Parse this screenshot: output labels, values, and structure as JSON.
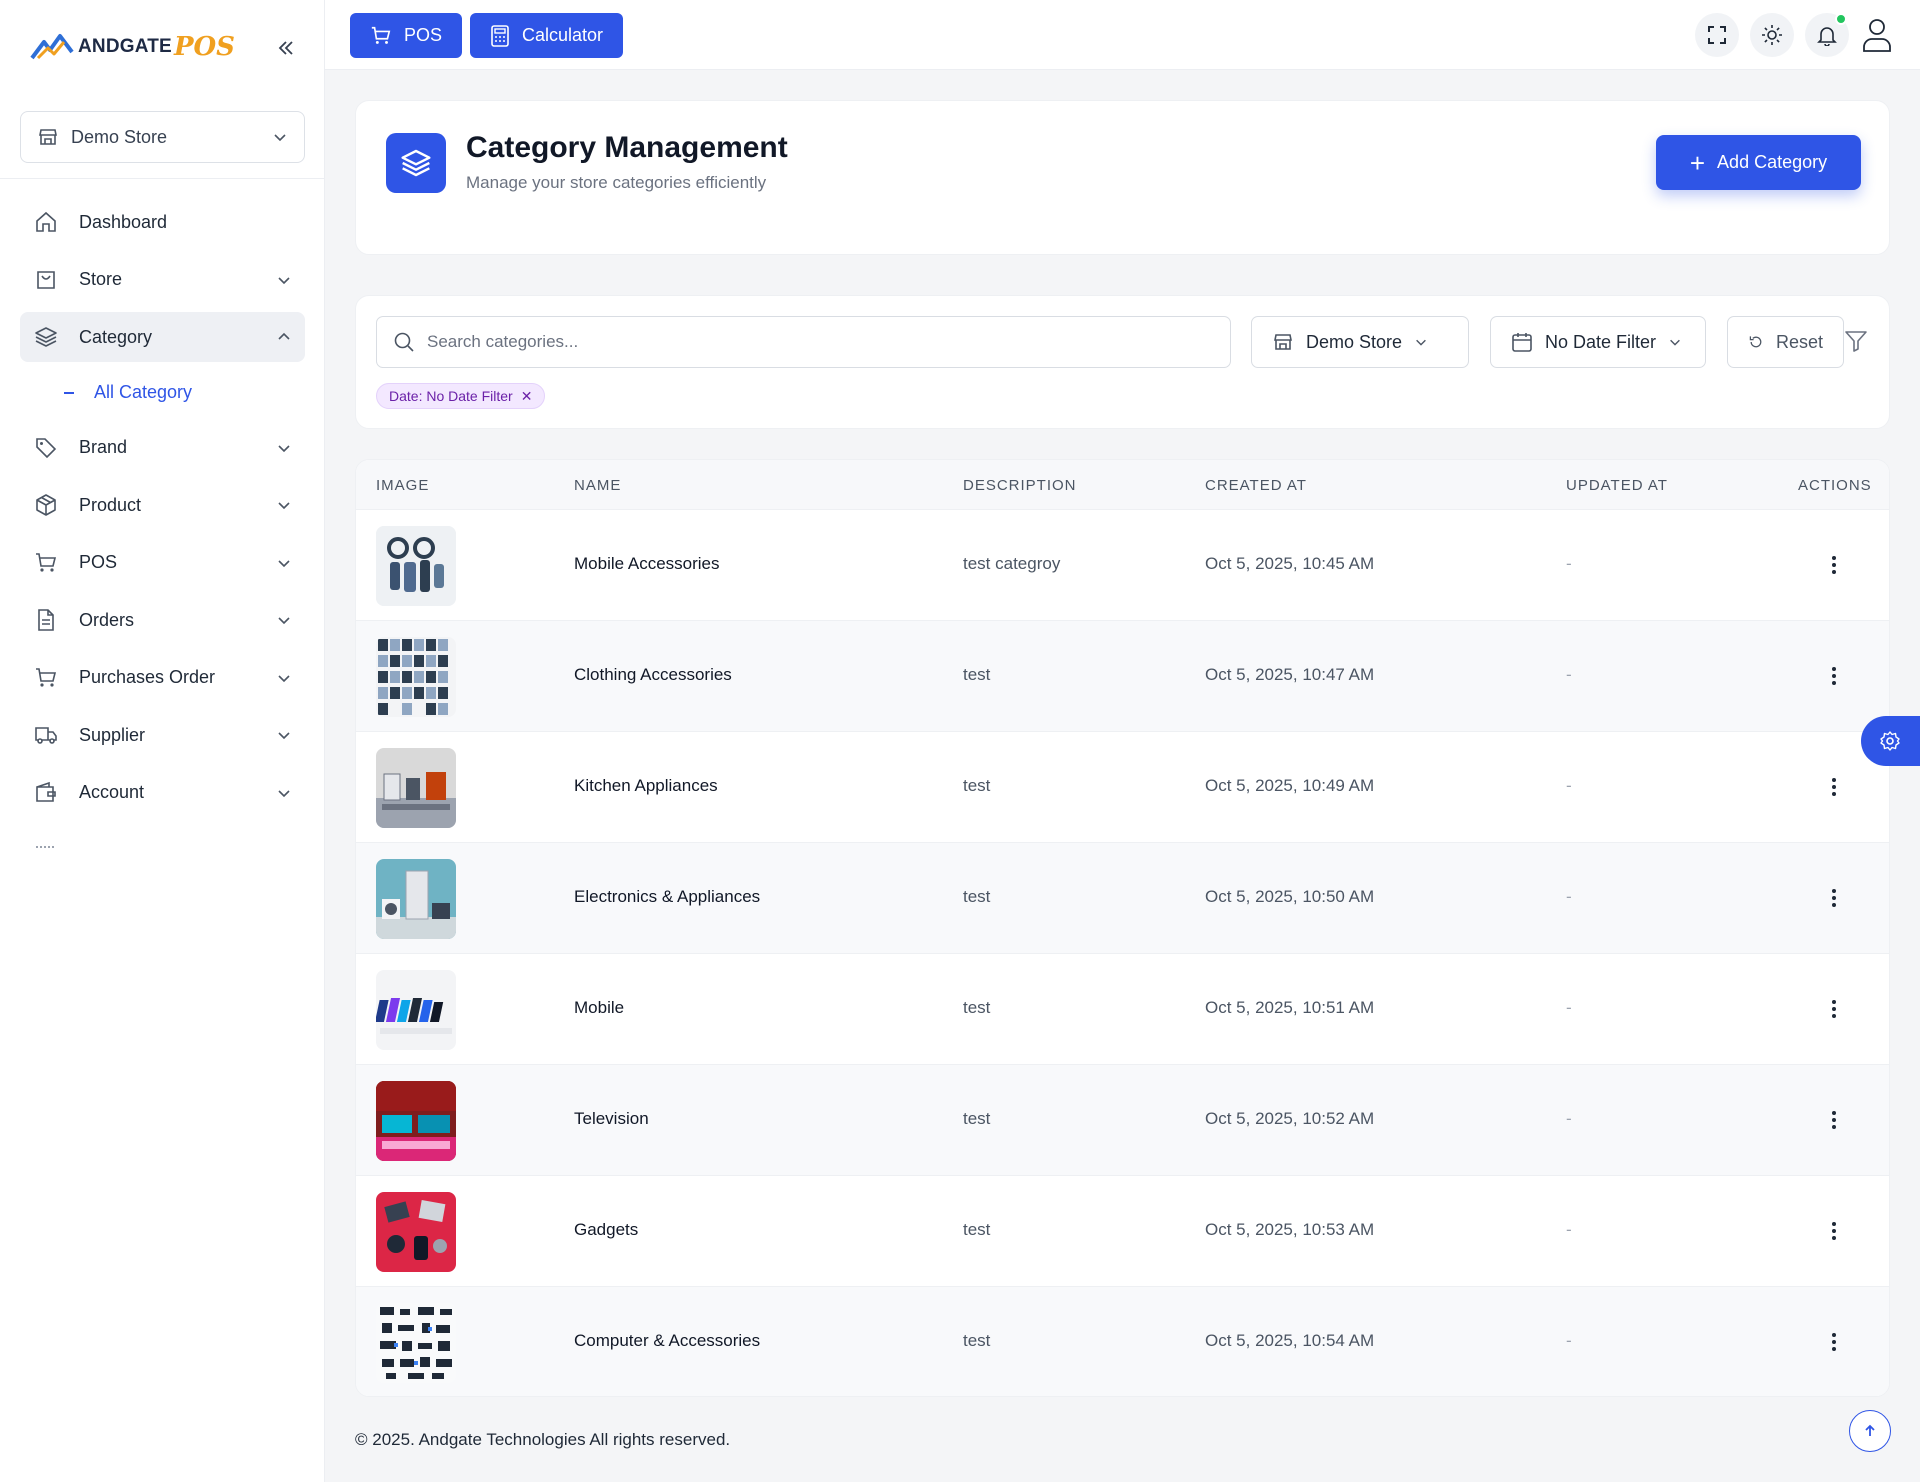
{
  "brand": {
    "name": "ANDGATE",
    "suffix": "POS"
  },
  "sidebar": {
    "store_select": "Demo Store",
    "items": [
      {
        "label": "Dashboard",
        "icon": "home-icon"
      },
      {
        "label": "Store",
        "icon": "store-bag-icon"
      },
      {
        "label": "Category",
        "icon": "layers-icon",
        "active": true
      },
      {
        "label": "Brand",
        "icon": "tag-icon"
      },
      {
        "label": "Product",
        "icon": "box-icon"
      },
      {
        "label": "POS",
        "icon": "cart-icon"
      },
      {
        "label": "Orders",
        "icon": "document-icon"
      },
      {
        "label": "Purchases Order",
        "icon": "cart-icon"
      },
      {
        "label": "Supplier",
        "icon": "truck-icon"
      },
      {
        "label": "Account",
        "icon": "wallet-icon"
      }
    ],
    "sub_item": "All Category"
  },
  "topbar": {
    "pos_label": "POS",
    "calculator_label": "Calculator"
  },
  "header": {
    "title": "Category Management",
    "subtitle": "Manage your store categories efficiently",
    "add_button": "Add Category"
  },
  "filters": {
    "search_placeholder": "Search categories...",
    "store": "Demo Store",
    "date": "No Date Filter",
    "reset": "Reset",
    "chip": "Date: No Date Filter",
    "chip_close": "✕"
  },
  "table": {
    "columns": [
      "IMAGE",
      "NAME",
      "DESCRIPTION",
      "CREATED AT",
      "UPDATED AT",
      "ACTIONS"
    ],
    "rows": [
      {
        "name": "Mobile Accessories",
        "description": "test categroy",
        "created": "Oct 5, 2025, 10:45 AM",
        "updated": "-"
      },
      {
        "name": "Clothing Accessories",
        "description": "test",
        "created": "Oct 5, 2025, 10:47 AM",
        "updated": "-"
      },
      {
        "name": "Kitchen Appliances",
        "description": "test",
        "created": "Oct 5, 2025, 10:49 AM",
        "updated": "-"
      },
      {
        "name": "Electronics & Appliances",
        "description": "test",
        "created": "Oct 5, 2025, 10:50 AM",
        "updated": "-"
      },
      {
        "name": "Mobile",
        "description": "test",
        "created": "Oct 5, 2025, 10:51 AM",
        "updated": "-"
      },
      {
        "name": "Television",
        "description": "test",
        "created": "Oct 5, 2025, 10:52 AM",
        "updated": "-"
      },
      {
        "name": "Gadgets",
        "description": "test",
        "created": "Oct 5, 2025, 10:53 AM",
        "updated": "-"
      },
      {
        "name": "Computer & Accessories",
        "description": "test",
        "created": "Oct 5, 2025, 10:54 AM",
        "updated": "-"
      }
    ]
  },
  "footer": {
    "text": "© 2025. Andgate Technologies All rights reserved."
  },
  "colors": {
    "primary": "#2f55e6",
    "accent": "#f0a020",
    "online": "#22c55e"
  }
}
